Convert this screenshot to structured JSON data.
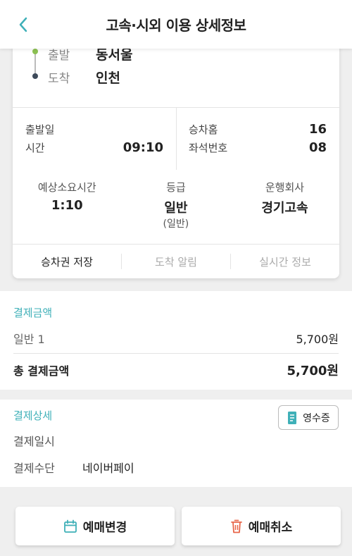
{
  "header": {
    "title": "고속·시외 이용 상세정보"
  },
  "route": {
    "departure_key": "출발",
    "departure_value": "동서울",
    "arrival_key": "도착",
    "arrival_value": "인천"
  },
  "info": {
    "date_label": "출발일",
    "date_value": "",
    "time_label": "시간",
    "time_value": "09:10",
    "platform_label": "승차홈",
    "platform_value": "16",
    "seat_label": "좌석번호",
    "seat_value": "08"
  },
  "stats": {
    "duration_label": "예상소요시간",
    "duration_value": "1:10",
    "grade_label": "등급",
    "grade_value": "일반",
    "grade_sub": "(일반)",
    "company_label": "운행회사",
    "company_value": "경기고속"
  },
  "actions": {
    "save_ticket": "승차권 저장",
    "arrival_alert": "도착 알림",
    "realtime_info": "실시간 정보"
  },
  "payment": {
    "title": "결제금액",
    "item_label": "일반 1",
    "item_value": "5,700원",
    "total_label": "총 결제금액",
    "total_value": "5,700원"
  },
  "payment_detail": {
    "title": "결제상세",
    "receipt_label": "영수증",
    "date_label": "결제일시",
    "date_value": "",
    "method_label": "결제수단",
    "method_value": "네이버페이"
  },
  "buttons": {
    "change": "예매변경",
    "cancel": "예매취소"
  },
  "colors": {
    "accent": "#3fb0b8",
    "departure_dot": "#8cc152",
    "arrival_dot": "#3d4a5a",
    "cancel_icon": "#e8664a"
  }
}
